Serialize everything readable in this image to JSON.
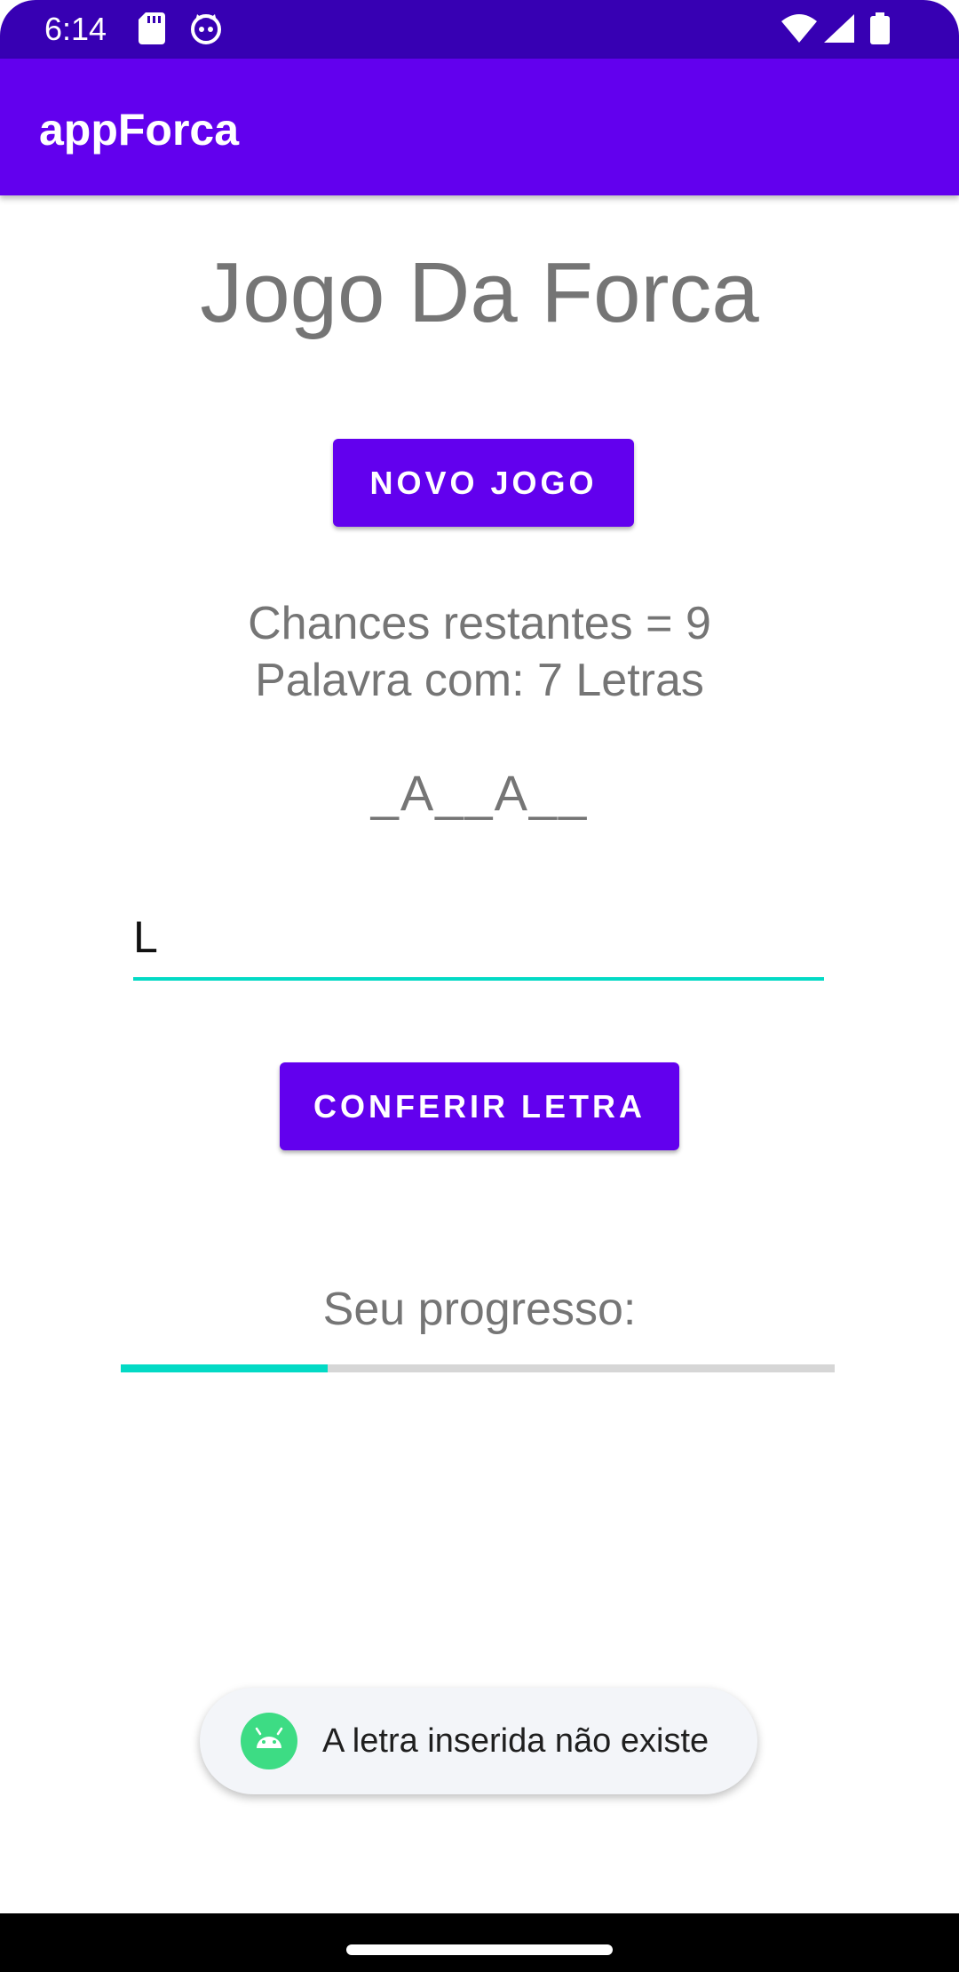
{
  "status_bar": {
    "time": "6:14",
    "icons_left": [
      "sd-card-icon",
      "cat-face-icon"
    ],
    "icons_right": [
      "wifi-icon",
      "signal-icon",
      "battery-icon"
    ]
  },
  "app_bar": {
    "title": "appForca"
  },
  "game": {
    "title": "Jogo Da Forca",
    "new_game_label": "NOVO JOGO",
    "chances_text": "Chances restantes = 9",
    "word_length_text": "Palavra com: 7 Letras",
    "word_mask": "_A__A__",
    "letter_input_value": "L",
    "check_letter_label": "CONFERIR LETRA",
    "progress_label": "Seu progresso:",
    "progress_fraction": 0.29
  },
  "toast": {
    "icon": "android-icon",
    "message": "A letra inserida não existe"
  },
  "colors": {
    "primary": "#6200EE",
    "primary_dark": "#3700B3",
    "accent": "#03DAC5"
  }
}
